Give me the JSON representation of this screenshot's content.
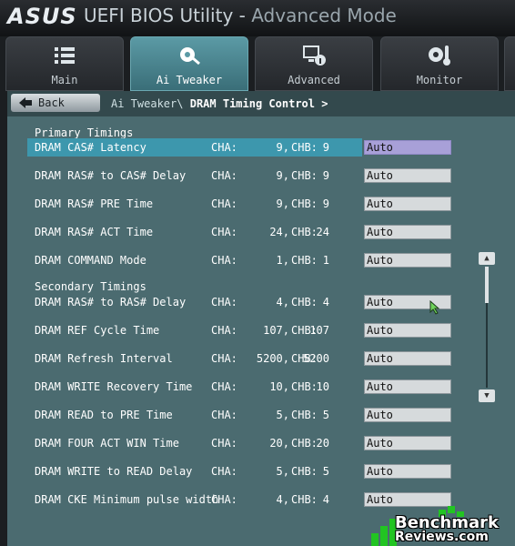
{
  "header": {
    "logo_text": "ASUS",
    "title": "UEFI BIOS Utility - ",
    "mode": "Advanced Mode"
  },
  "tabs": [
    {
      "label": "Main",
      "icon": "list-icon"
    },
    {
      "label": "Ai Tweaker",
      "icon": "fan-icon"
    },
    {
      "label": "Advanced",
      "icon": "monitor-info-icon"
    },
    {
      "label": "Monitor",
      "icon": "thermometer-fan-icon"
    }
  ],
  "active_tab": "Ai Tweaker",
  "navbar": {
    "back_label": "Back",
    "breadcrumb_parent": "Ai Tweaker\\",
    "breadcrumb_current": "DRAM Timing Control",
    "breadcrumb_chevron": ">"
  },
  "sections": {
    "primary": "Primary Timings",
    "secondary": "Secondary Timings"
  },
  "timings": [
    {
      "label": "DRAM CAS# Latency",
      "cha": "9,",
      "chb": "9",
      "value": "Auto",
      "selected": true
    },
    {
      "label": "DRAM RAS# to CAS# Delay",
      "cha": "9,",
      "chb": "9",
      "value": "Auto"
    },
    {
      "label": "DRAM RAS# PRE Time",
      "cha": "9,",
      "chb": "9",
      "value": "Auto"
    },
    {
      "label": "DRAM RAS# ACT Time",
      "cha": "24,",
      "chb": "24",
      "value": "Auto"
    },
    {
      "label": "DRAM COMMAND Mode",
      "cha": "1,",
      "chb": "1",
      "value": "Auto"
    },
    {
      "label": "DRAM RAS# to RAS# Delay",
      "cha": "4,",
      "chb": "4",
      "value": "Auto"
    },
    {
      "label": "DRAM REF Cycle Time",
      "cha": "107,",
      "chb": "107",
      "value": "Auto"
    },
    {
      "label": "DRAM Refresh Interval",
      "cha": "5200,",
      "chb": "5200",
      "value": "Auto"
    },
    {
      "label": "DRAM WRITE Recovery Time",
      "cha": "10,",
      "chb": "10",
      "value": "Auto"
    },
    {
      "label": "DRAM READ to PRE Time",
      "cha": "5,",
      "chb": "5",
      "value": "Auto"
    },
    {
      "label": "DRAM FOUR ACT WIN Time",
      "cha": "20,",
      "chb": "20",
      "value": "Auto"
    },
    {
      "label": "DRAM WRITE to READ Delay",
      "cha": "5,",
      "chb": "5",
      "value": "Auto"
    },
    {
      "label": "DRAM CKE Minimum pulse width",
      "cha": "4,",
      "chb": "4",
      "value": "Auto"
    }
  ],
  "channel_labels": {
    "cha": "CHA:",
    "chb": "CHB:"
  },
  "watermark": {
    "line1": "Benchmark",
    "line2": "Reviews.com"
  },
  "colors": {
    "accent": "#3d97ad",
    "panel": "#4b6b70",
    "selected_field": "#a8a0d8"
  }
}
